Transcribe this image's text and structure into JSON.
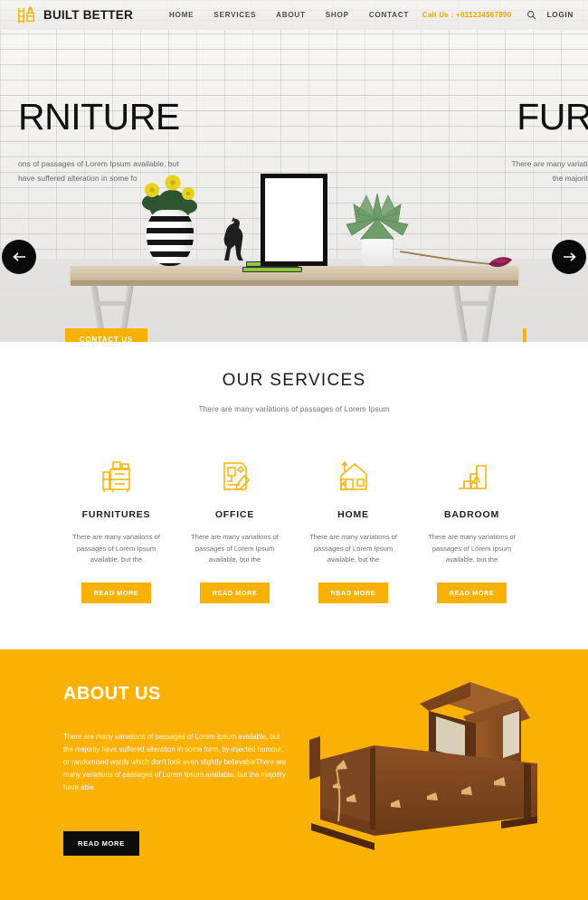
{
  "header": {
    "logo": {
      "text": "BUILT BETTER",
      "icon": "furniture-logo-icon",
      "color": "#f9b100"
    },
    "nav": [
      {
        "label": "HOME"
      },
      {
        "label": "SERVICES"
      },
      {
        "label": "ABOUT"
      },
      {
        "label": "SHOP"
      },
      {
        "label": "CONTACT"
      }
    ],
    "call_us": "Call Us : +011234567890",
    "search_icon": "search-icon",
    "login_label": "LOGIN"
  },
  "hero": {
    "current_slide": {
      "title": "RNITURE",
      "subtitle": "ons of passages of Lorem Ipsum available, but\nhave suffered alteration in some fo",
      "cta_label": "CONTACT US"
    },
    "next_slide": {
      "title": "FUR",
      "subtitle": "There are many variatio\nthe majority"
    },
    "prev_arrow": "arrow-left-icon",
    "next_arrow": "arrow-right-icon"
  },
  "services": {
    "title": "OUR SERVICES",
    "subtitle": "There are many variations of passages of Lorem Ipsum",
    "items": [
      {
        "icon": "cabinet-icon",
        "name": "FURNITURES",
        "desc": "There are many variations of passages of Lorem Ipsum available, but the",
        "button": "READ MORE"
      },
      {
        "icon": "office-desk-icon",
        "name": "OFFICE",
        "desc": "There are many variations of passages of Lorem Ipsum available, but the",
        "button": "READ MORE"
      },
      {
        "icon": "house-icon",
        "name": "HOME",
        "desc": "There are many variations of passages of Lorem Ipsum available, but the",
        "button": "READ MORE"
      },
      {
        "icon": "stairs-plant-icon",
        "name": "BADROOM",
        "desc": "There are many variations of passages of Lorem Ipsum available, but the",
        "button": "READ MORE"
      }
    ]
  },
  "about": {
    "title": "ABOUT US",
    "text": "There are many variations of passages of Lorem Ipsum available, but the majority have suffered alteration in some form, by injected humour, or randomised words which don't look even slightly believableThere are many variations of passages of Lorem Ipsum available, but the majority have able",
    "button": "READ MORE",
    "image": "wooden-cradle-image",
    "background_color": "#fbb103"
  }
}
